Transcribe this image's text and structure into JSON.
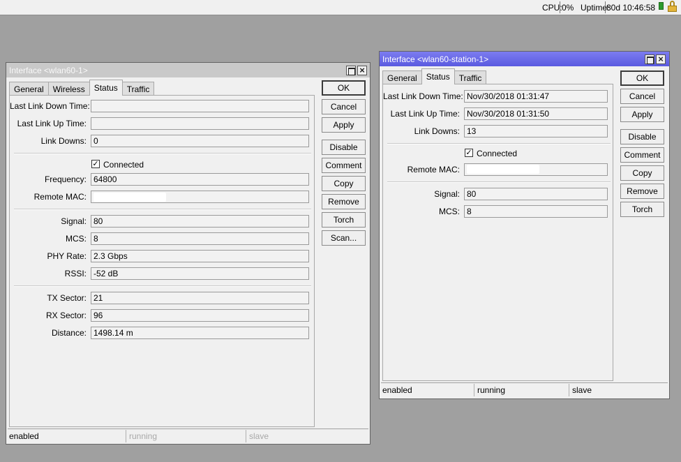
{
  "topbar": {
    "cpu_label": "CPU:",
    "cpu_value": "0%",
    "uptime_label": "Uptime:",
    "uptime_value": "80d 10:46:58"
  },
  "win1": {
    "title": "Interface <wlan60-1>",
    "tabs": [
      "General",
      "Wireless",
      "Status",
      "Traffic"
    ],
    "active_tab": "Status",
    "fields": {
      "last_link_down_time": {
        "label": "Last Link Down Time:",
        "value": ""
      },
      "last_link_up_time": {
        "label": "Last Link Up Time:",
        "value": ""
      },
      "link_downs": {
        "label": "Link Downs:",
        "value": "0"
      },
      "connected": {
        "label": "Connected",
        "checked": true
      },
      "frequency": {
        "label": "Frequency:",
        "value": "64800"
      },
      "remote_mac": {
        "label": "Remote MAC:",
        "value": ""
      },
      "signal": {
        "label": "Signal:",
        "value": "80"
      },
      "mcs": {
        "label": "MCS:",
        "value": "8"
      },
      "phy_rate": {
        "label": "PHY Rate:",
        "value": "2.3 Gbps"
      },
      "rssi": {
        "label": "RSSI:",
        "value": "-52 dB"
      },
      "tx_sector": {
        "label": "TX Sector:",
        "value": "21"
      },
      "rx_sector": {
        "label": "RX Sector:",
        "value": "96"
      },
      "distance": {
        "label": "Distance:",
        "value": "1498.14 m"
      }
    },
    "buttons": {
      "ok": "OK",
      "cancel": "Cancel",
      "apply": "Apply",
      "disable": "Disable",
      "comment": "Comment",
      "copy": "Copy",
      "remove": "Remove",
      "torch": "Torch",
      "scan": "Scan..."
    },
    "status": [
      "enabled",
      "running",
      "slave"
    ]
  },
  "win2": {
    "title": "Interface <wlan60-station-1>",
    "tabs": [
      "General",
      "Status",
      "Traffic"
    ],
    "active_tab": "Status",
    "fields": {
      "last_link_down_time": {
        "label": "Last Link Down Time:",
        "value": "Nov/30/2018 01:31:47"
      },
      "last_link_up_time": {
        "label": "Last Link Up Time:",
        "value": "Nov/30/2018 01:31:50"
      },
      "link_downs": {
        "label": "Link Downs:",
        "value": "13"
      },
      "connected": {
        "label": "Connected",
        "checked": true
      },
      "remote_mac": {
        "label": "Remote MAC:",
        "value": ""
      },
      "signal": {
        "label": "Signal:",
        "value": "80"
      },
      "mcs": {
        "label": "MCS:",
        "value": "8"
      }
    },
    "buttons": {
      "ok": "OK",
      "cancel": "Cancel",
      "apply": "Apply",
      "disable": "Disable",
      "comment": "Comment",
      "copy": "Copy",
      "remove": "Remove",
      "torch": "Torch"
    },
    "status": [
      "enabled",
      "running",
      "slave"
    ]
  },
  "colors": {
    "desktop": "#a0a0a0",
    "active_titlebar": "#6a6ae8",
    "inactive_titlebar": "#c9c9c9",
    "tray_green": "#2e9a2e"
  }
}
